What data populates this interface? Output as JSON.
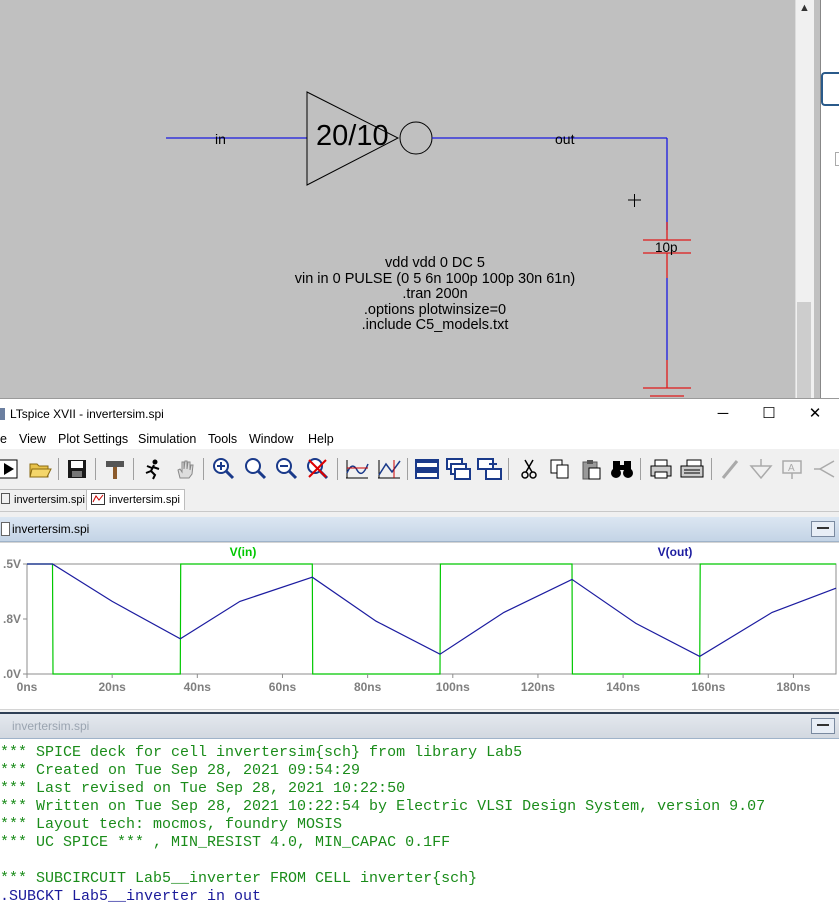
{
  "schematic": {
    "inverter_label": "20/10",
    "net_in": "in",
    "net_out": "out",
    "cap_label": "10p",
    "spice_lines": [
      "vdd vdd 0 DC 5",
      "vin in 0 PULSE (0 5 6n 100p 100p 30n 61n)",
      ".tran 200n",
      ".options plotwinsize=0",
      ".include C5_models.txt"
    ]
  },
  "window": {
    "title": "LTspice XVII - invertersim.spi",
    "minimize": "─",
    "maximize": "☐",
    "close": "✕"
  },
  "menu": {
    "items": [
      "e",
      "View",
      "Plot Settings",
      "Simulation",
      "Tools",
      "Window",
      "Help"
    ]
  },
  "toolbar": {
    "icons": [
      "run-icon",
      "open-icon",
      "save-icon",
      "hammer-icon",
      "run-man-icon",
      "pan-hand-icon",
      "zoom-in-icon",
      "zoom-area-icon",
      "zoom-out-icon",
      "zoom-cancel-icon",
      "autorange-icon",
      "cursor-icon",
      "tile-horizontal-icon",
      "cascade-icon",
      "tile-vertical-icon",
      "cut-icon",
      "copy-icon",
      "paste-icon",
      "find-icon",
      "print-setup-icon",
      "print-icon",
      "pencil-icon",
      "ground-icon",
      "label-icon",
      "diode-icon"
    ]
  },
  "tabs": [
    {
      "label": "invertersim.spi",
      "active": false
    },
    {
      "label": "invertersim.spi",
      "active": true
    }
  ],
  "plot_pane": {
    "title": "invertersim.spi"
  },
  "text_pane": {
    "title": "invertersim.spi",
    "lines": [
      "*** SPICE deck for cell invertersim{sch} from library Lab5",
      "*** Created on Tue Sep 28, 2021 09:54:29",
      "*** Last revised on Tue Sep 28, 2021 10:22:50",
      "*** Written on Tue Sep 28, 2021 10:22:54 by Electric VLSI Design System, version 9.07",
      "*** Layout tech: mocmos, foundry MOSIS",
      "*** UC SPICE *** , MIN_RESIST 4.0, MIN_CAPAC 0.1FF",
      "",
      "*** SUBCIRCUIT Lab5__inverter FROM CELL inverter{sch}",
      ".SUBCKT Lab5__inverter in out"
    ]
  },
  "colors": {
    "vin": "#00c800",
    "vout": "#1c1ca0",
    "axis_text": "#7f7f7f",
    "wire": "#1a1ae0",
    "cap": "#e01a1a"
  },
  "chart_data": {
    "type": "line",
    "series": [
      {
        "name": "V(in)",
        "x": [
          0,
          6,
          6.1,
          36,
          36.1,
          67,
          67.1,
          97,
          97.1,
          128,
          128.1,
          158,
          158.1,
          190
        ],
        "values": [
          5,
          5,
          0,
          0,
          5,
          5,
          0,
          0,
          5,
          5,
          0,
          0,
          5,
          5
        ]
      },
      {
        "name": "V(out)",
        "x": [
          0,
          6,
          20,
          36,
          50,
          67,
          82,
          97,
          112,
          128,
          143,
          158,
          175,
          190
        ],
        "values": [
          5,
          5,
          3.3,
          1.6,
          3.3,
          4.4,
          2.4,
          0.9,
          2.8,
          4.3,
          2.3,
          0.8,
          2.8,
          3.9
        ]
      }
    ],
    "x_ticks": [
      "0ns",
      "20ns",
      "40ns",
      "60ns",
      "80ns",
      "100ns",
      "120ns",
      "140ns",
      "160ns",
      "180ns"
    ],
    "y_ticks": [
      ".5V",
      ".8V",
      ".0V"
    ],
    "xlim": [
      0,
      190
    ],
    "ylim": [
      0,
      5
    ],
    "grid": false
  }
}
